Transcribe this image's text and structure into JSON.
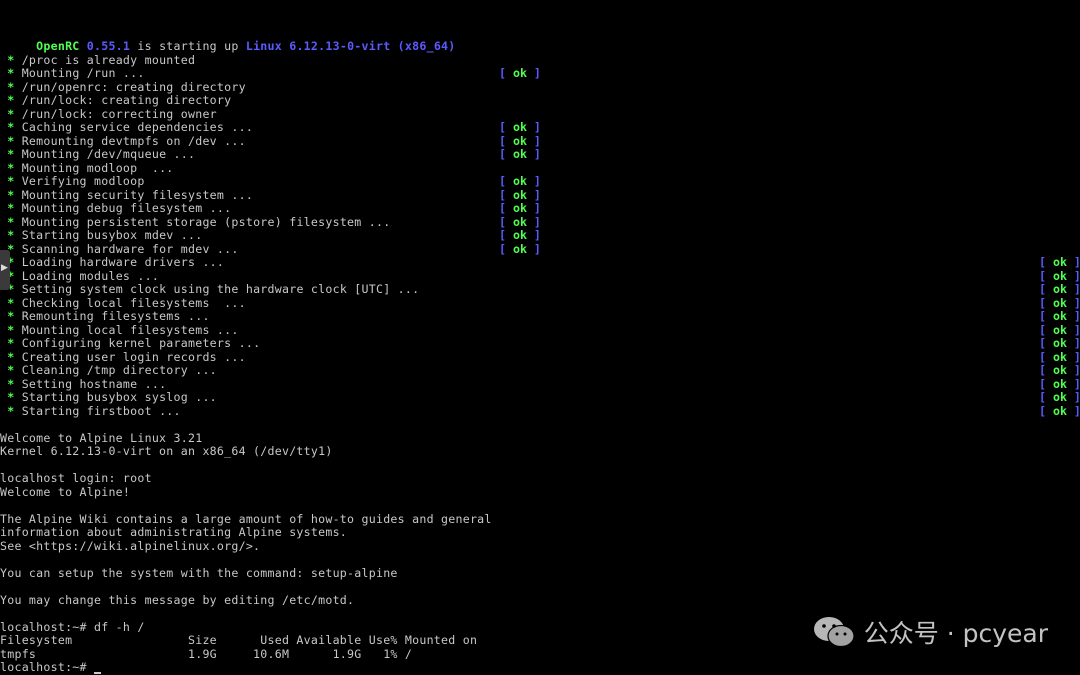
{
  "header": {
    "prefix": " OpenRC ",
    "version": "0.55.1",
    "middle": " is starting up ",
    "kernel": "Linux 6.12.13-0-virt (x86_64)"
  },
  "boot_lines": [
    {
      "text": "/proc is already mounted",
      "status": ""
    },
    {
      "text": "Mounting /run ...",
      "status": "ok",
      "col": "mid"
    },
    {
      "text": "/run/openrc: creating directory",
      "status": ""
    },
    {
      "text": "/run/lock: creating directory",
      "status": ""
    },
    {
      "text": "/run/lock: correcting owner",
      "status": ""
    },
    {
      "text": "Caching service dependencies ...",
      "status": "ok",
      "col": "mid"
    },
    {
      "text": "Remounting devtmpfs on /dev ...",
      "status": "ok",
      "col": "mid"
    },
    {
      "text": "Mounting /dev/mqueue ...",
      "status": "ok",
      "col": "mid"
    },
    {
      "text": "Mounting modloop  ...",
      "status": ""
    },
    {
      "text": "Verifying modloop",
      "status": "ok",
      "col": "mid"
    },
    {
      "text": "Mounting security filesystem ...",
      "status": "ok",
      "col": "mid"
    },
    {
      "text": "Mounting debug filesystem ...",
      "status": "ok",
      "col": "mid"
    },
    {
      "text": "Mounting persistent storage (pstore) filesystem ...",
      "status": "ok",
      "col": "mid"
    },
    {
      "text": "Starting busybox mdev ...",
      "status": "ok",
      "col": "mid"
    },
    {
      "text": "Scanning hardware for mdev ...",
      "status": "ok",
      "col": "mid"
    },
    {
      "text": "Loading hardware drivers ...",
      "status": "ok",
      "col": "right"
    },
    {
      "text": "Loading modules ...",
      "status": "ok",
      "col": "right"
    },
    {
      "text": "Setting system clock using the hardware clock [UTC] ...",
      "status": "ok",
      "col": "right"
    },
    {
      "text": "Checking local filesystems  ...",
      "status": "ok",
      "col": "right"
    },
    {
      "text": "Remounting filesystems ...",
      "status": "ok",
      "col": "right"
    },
    {
      "text": "Mounting local filesystems ...",
      "status": "ok",
      "col": "right"
    },
    {
      "text": "Configuring kernel parameters ...",
      "status": "ok",
      "col": "right"
    },
    {
      "text": "Creating user login records ...",
      "status": "ok",
      "col": "right"
    },
    {
      "text": "Cleaning /tmp directory ...",
      "status": "ok",
      "col": "right"
    },
    {
      "text": "Setting hostname ...",
      "status": "ok",
      "col": "right"
    },
    {
      "text": "Starting busybox syslog ...",
      "status": "ok",
      "col": "right"
    },
    {
      "text": "Starting firstboot ...",
      "status": "ok",
      "col": "right"
    }
  ],
  "status_ok": "ok",
  "star": "*",
  "console": [
    "",
    "Welcome to Alpine Linux 3.21",
    "Kernel 6.12.13-0-virt on an x86_64 (/dev/tty1)",
    "",
    "localhost login: root",
    "Welcome to Alpine!",
    "",
    "The Alpine Wiki contains a large amount of how-to guides and general",
    "information about administrating Alpine systems.",
    "See <https://wiki.alpinelinux.org/>.",
    "",
    "You can setup the system with the command: setup-alpine",
    "",
    "You may change this message by editing /etc/motd.",
    "",
    "localhost:~# df -h /",
    "Filesystem                Size      Used Available Use% Mounted on",
    "tmpfs                     1.9G     10.6M      1.9G   1% /",
    "localhost:~# "
  ],
  "watermark": {
    "label": "公众号 · pcyear",
    "icon": "wechat-icon"
  },
  "colors": {
    "background": "#000000",
    "text": "#c8c8c8",
    "green": "#50ff50",
    "blue": "#5a5aff"
  }
}
